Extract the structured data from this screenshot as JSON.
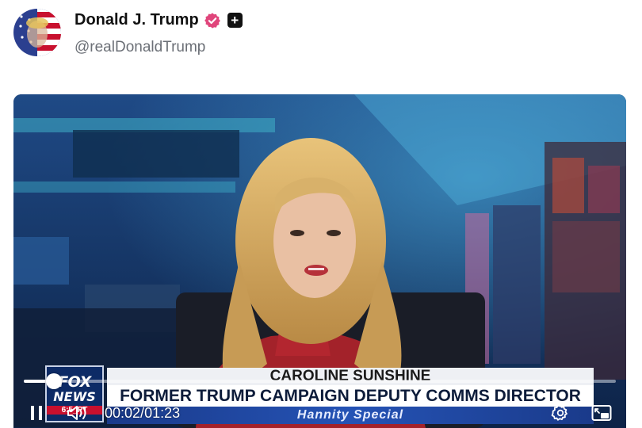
{
  "profile": {
    "display_name": "Donald J. Trump",
    "handle": "@realDonaldTrump",
    "verified_icon": "verified-badge-icon",
    "subscribe_icon": "plus-icon",
    "sub_badge_glyph": "+"
  },
  "video": {
    "overlay": {
      "network_logo_line1": "FOX",
      "network_logo_line2": "NEWS",
      "network_logo_line3": "6:5_PT",
      "name": "CAROLINE SUNSHINE",
      "title": "FORMER TRUMP CAMPAIGN DEPUTY COMMS DIRECTOR",
      "show": "Hannity Special"
    },
    "player": {
      "current_time": "00:02",
      "separator": "/",
      "duration": "01:23",
      "progress_fraction": 0.024,
      "icons": [
        "pause-icon",
        "volume-icon",
        "settings-icon",
        "picture-in-picture-icon"
      ]
    }
  },
  "colors": {
    "verified_badge": "#e0457b",
    "news_blue": "#0d2b66",
    "news_red": "#c8102e"
  }
}
